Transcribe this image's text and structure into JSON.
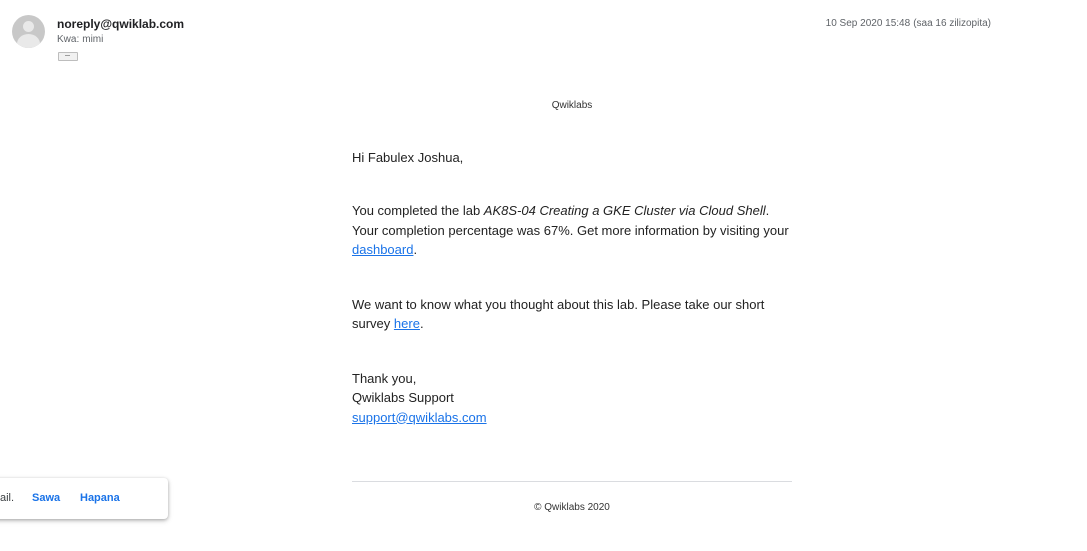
{
  "header": {
    "sender": "noreply@qwiklab.com",
    "to_label": "Kwa:",
    "to_value": "mimi",
    "date": "10 Sep 2020 15:48",
    "ago": "(saa 16 zilizopita)"
  },
  "email": {
    "brand": "Qwiklabs",
    "greeting": "Hi Fabulex Joshua,",
    "p1_before": "You completed the lab ",
    "p1_course": "AK8S-04 Creating a GKE Cluster via Cloud Shell",
    "p1_after": ". Your completion percentage was 67%. Get more information by visiting your ",
    "p1_link": "dashboard",
    "p1_end": ".",
    "p2_before": "We want to know what you thought about this lab. Please take our short survey ",
    "p2_link": "here",
    "p2_end": ".",
    "signoff": "Thank you,",
    "team": "Qwiklabs Support",
    "support_email": "support@qwiklabs.com",
    "footer": "© Qwiklabs 2020"
  },
  "snackbar": {
    "message": "ail.",
    "action1": "Sawa",
    "action2": "Hapana"
  }
}
